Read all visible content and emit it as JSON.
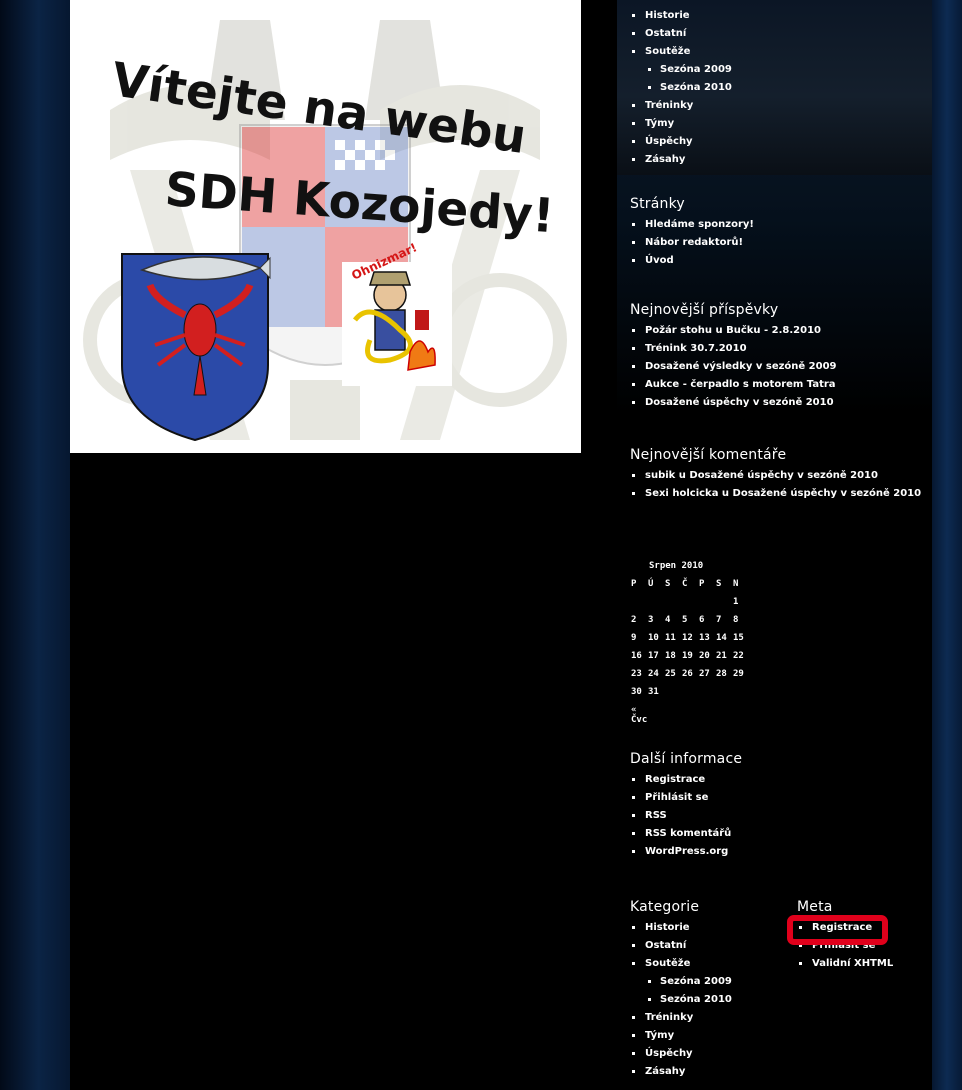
{
  "banner": {
    "line1": "Vítejte na webu",
    "line2": "SDH Kozojedy!",
    "badge_text": "Ohnizmar!"
  },
  "top_categories": {
    "items": [
      {
        "label": "Historie",
        "level": 0
      },
      {
        "label": "Ostatní",
        "level": 0
      },
      {
        "label": "Soutěže",
        "level": 0
      },
      {
        "label": "Sezóna 2009",
        "level": 1
      },
      {
        "label": "Sezóna 2010",
        "level": 1
      },
      {
        "label": "Tréninky",
        "level": 0
      },
      {
        "label": "Týmy",
        "level": 0
      },
      {
        "label": "Úspěchy",
        "level": 0
      },
      {
        "label": "Zásahy",
        "level": 0
      }
    ]
  },
  "pages": {
    "title": "Stránky",
    "items": [
      "Hledáme sponzory!",
      "Nábor redaktorů!",
      "Úvod"
    ]
  },
  "recent_posts": {
    "title": "Nejnovější příspěvky",
    "items": [
      "Požár stohu u Bučku - 2.8.2010",
      "Trénink 30.7.2010",
      "Dosažené výsledky v sezóně 2009",
      "Aukce - čerpadlo s motorem Tatra",
      "Dosažené úspěchy v sezóně 2010"
    ]
  },
  "recent_comments": {
    "title": "Nejnovější komentáře",
    "items": [
      "subik u Dosažené úspěchy v sezóně 2010",
      "Sexi holcicka u Dosažené úspěchy v sezóně 2010"
    ]
  },
  "calendar": {
    "caption": "Srpen 2010",
    "weekdays": [
      "P",
      "Ú",
      "S",
      "Č",
      "P",
      "S",
      "N"
    ],
    "weeks": [
      [
        "",
        "",
        "",
        "",
        "",
        "",
        "1"
      ],
      [
        "2",
        "3",
        "4",
        "5",
        "6",
        "7",
        "8"
      ],
      [
        "9",
        "10",
        "11",
        "12",
        "13",
        "14",
        "15"
      ],
      [
        "16",
        "17",
        "18",
        "19",
        "20",
        "21",
        "22"
      ],
      [
        "23",
        "24",
        "25",
        "26",
        "27",
        "28",
        "29"
      ],
      [
        "30",
        "31",
        "",
        "",
        "",
        "",
        ""
      ]
    ],
    "prev_link": "« Čvc"
  },
  "more_info": {
    "title": "Další informace",
    "items": [
      "Registrace",
      "Přihlásit se",
      "RSS",
      "RSS komentářů",
      "WordPress.org"
    ]
  },
  "categories": {
    "title": "Kategorie",
    "items": [
      {
        "label": "Historie",
        "level": 0
      },
      {
        "label": "Ostatní",
        "level": 0
      },
      {
        "label": "Soutěže",
        "level": 0
      },
      {
        "label": "Sezóna 2009",
        "level": 1
      },
      {
        "label": "Sezóna 2010",
        "level": 1
      },
      {
        "label": "Tréninky",
        "level": 0
      },
      {
        "label": "Týmy",
        "level": 0
      },
      {
        "label": "Úspěchy",
        "level": 0
      },
      {
        "label": "Zásahy",
        "level": 0
      }
    ]
  },
  "meta": {
    "title": "Meta",
    "items": [
      "Registrace",
      "Přihlásit se",
      "Validní XHTML"
    ]
  },
  "colors": {
    "highlight": "#e0001b",
    "background": "#000000",
    "side_blue": "#0b2445"
  }
}
